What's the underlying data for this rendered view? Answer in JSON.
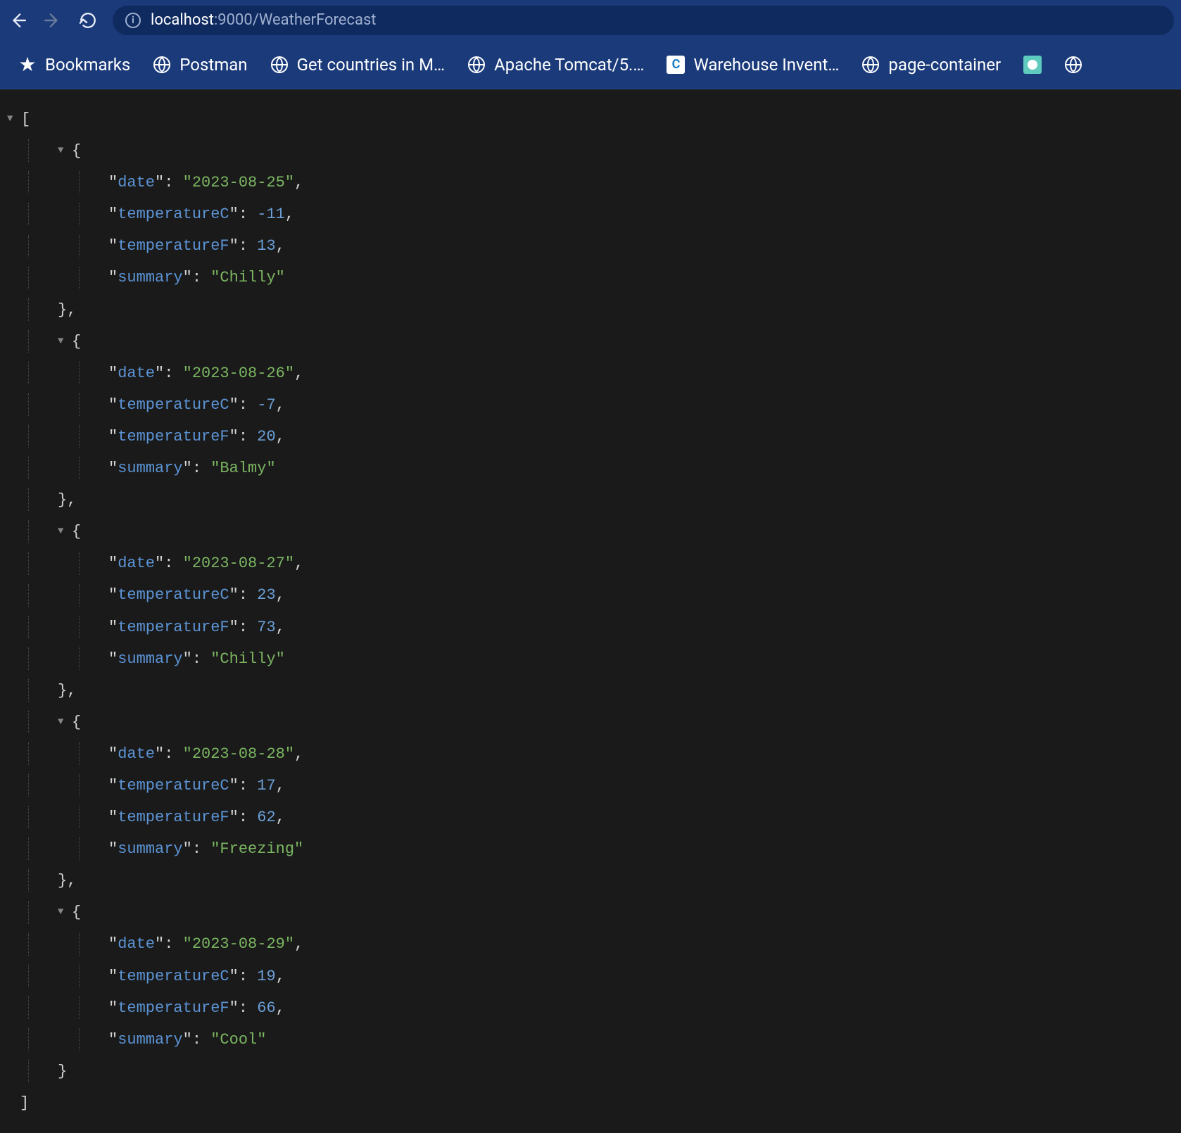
{
  "browser": {
    "url_host": "localhost",
    "url_rest": ":9000/WeatherForecast"
  },
  "bookmarks": {
    "items": [
      {
        "label": "Bookmarks",
        "icon": "star"
      },
      {
        "label": "Postman",
        "icon": "globe"
      },
      {
        "label": "Get countries in M…",
        "icon": "globe"
      },
      {
        "label": "Apache Tomcat/5.…",
        "icon": "globe"
      },
      {
        "label": "Warehouse Invent…",
        "icon": "square-c"
      },
      {
        "label": "page-container",
        "icon": "globe"
      },
      {
        "label": "",
        "icon": "teal"
      },
      {
        "label": "",
        "icon": "globe"
      }
    ]
  },
  "json": {
    "keys": {
      "date": "date",
      "temperatureC": "temperatureC",
      "temperatureF": "temperatureF",
      "summary": "summary"
    },
    "entries": [
      {
        "date": "2023-08-25",
        "temperatureC": "-11",
        "temperatureF": "13",
        "summary": "Chilly"
      },
      {
        "date": "2023-08-26",
        "temperatureC": "-7",
        "temperatureF": "20",
        "summary": "Balmy"
      },
      {
        "date": "2023-08-27",
        "temperatureC": "23",
        "temperatureF": "73",
        "summary": "Chilly"
      },
      {
        "date": "2023-08-28",
        "temperatureC": "17",
        "temperatureF": "62",
        "summary": "Freezing"
      },
      {
        "date": "2023-08-29",
        "temperatureC": "19",
        "temperatureF": "66",
        "summary": "Cool"
      }
    ]
  }
}
